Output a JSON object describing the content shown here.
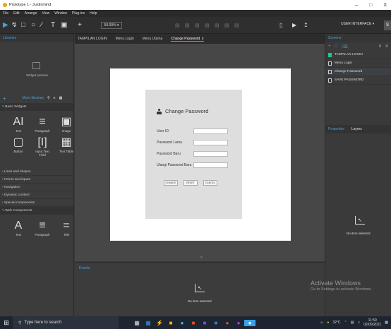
{
  "window": {
    "title": "Prototype 1 - Justinmind",
    "min": "–",
    "max": "□",
    "close": "X"
  },
  "menu": [
    "File",
    "Edit",
    "Arrange",
    "View",
    "Window",
    "Plug-ins",
    "Help"
  ],
  "toolbar": {
    "zoom": "50.00%",
    "ui_button": "USER INTERFACE",
    "user_initial": "S"
  },
  "left_panel": {
    "header": "Libraries",
    "widget_preview": "Widget preview",
    "more_libraries": "More libraries",
    "basic_widgets": "Basic Widgets",
    "widgets_row1": [
      "Text",
      "Paragraph",
      "Image"
    ],
    "widgets_row2": [
      "Button",
      "Input Text Field",
      "Text Table"
    ],
    "sections": [
      "Lines and shapes",
      "Forms and inputs",
      "Navigation",
      "Dynamic content",
      "Special components"
    ],
    "web_components": "Web Components",
    "web_widgets": [
      "Text",
      "Paragraph",
      "Title"
    ]
  },
  "tabs": [
    "TAMPILAN LOGIN",
    "Menu Login",
    "Menu Utama",
    "Change Password"
  ],
  "tab_close": "x",
  "card": {
    "title": "Change Password",
    "fields": [
      "User ID",
      "Password Lama",
      "Password Baru",
      "Ulangi Password Baru"
    ],
    "buttons": [
      "CHANGE",
      "RESET",
      "CANCEL"
    ]
  },
  "events": {
    "tab": "Events",
    "empty": "No item selected"
  },
  "right_panel": {
    "header": "Screens",
    "screens": [
      "TAMPILAN LOGIN",
      "Menu Login",
      "Change Password",
      "SAVE PASSWORD"
    ],
    "tabs": [
      "Properties",
      "Layers"
    ],
    "empty": "No item selected"
  },
  "watermark": {
    "line1": "Activate Windows",
    "line2": "Go to Settings to activate Windows."
  },
  "taskbar": {
    "search": "Type here to search",
    "temp": "32°C",
    "time": "11:59",
    "date": "02/09/2021"
  }
}
